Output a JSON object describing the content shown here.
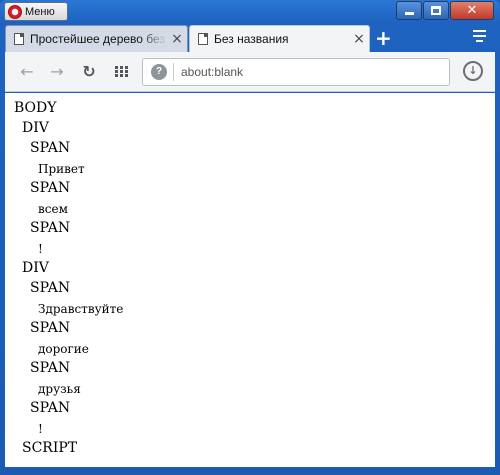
{
  "titlebar": {
    "menu_label": "Меню"
  },
  "tabs": [
    {
      "title": "Простейшее дерево без …",
      "close": "×"
    },
    {
      "title": "Без названия",
      "close": "×"
    }
  ],
  "new_tab_label": "+",
  "toolbar": {
    "back": "←",
    "forward": "→",
    "reload": "↻",
    "download": "↓"
  },
  "address": {
    "value": "about:blank",
    "site_icon": "?"
  },
  "tree": [
    {
      "text": "BODY",
      "kind": "tag",
      "indent": 0
    },
    {
      "text": "DIV",
      "kind": "tag",
      "indent": 1
    },
    {
      "text": "SPAN",
      "kind": "tag",
      "indent": 2
    },
    {
      "text": "Привет",
      "kind": "txt",
      "indent": 3
    },
    {
      "text": "SPAN",
      "kind": "tag",
      "indent": 2
    },
    {
      "text": "всем",
      "kind": "txt",
      "indent": 3
    },
    {
      "text": "SPAN",
      "kind": "tag",
      "indent": 2
    },
    {
      "text": "!",
      "kind": "txt",
      "indent": 3
    },
    {
      "text": "DIV",
      "kind": "tag",
      "indent": 1
    },
    {
      "text": "SPAN",
      "kind": "tag",
      "indent": 2
    },
    {
      "text": "Здравствуйте",
      "kind": "txt",
      "indent": 3
    },
    {
      "text": "SPAN",
      "kind": "tag",
      "indent": 2
    },
    {
      "text": "дорогие",
      "kind": "txt",
      "indent": 3
    },
    {
      "text": "SPAN",
      "kind": "tag",
      "indent": 2
    },
    {
      "text": "друзья",
      "kind": "txt",
      "indent": 3
    },
    {
      "text": "SPAN",
      "kind": "tag",
      "indent": 2
    },
    {
      "text": "!",
      "kind": "txt",
      "indent": 3
    },
    {
      "text": "SCRIPT",
      "kind": "tag",
      "indent": 1
    }
  ]
}
